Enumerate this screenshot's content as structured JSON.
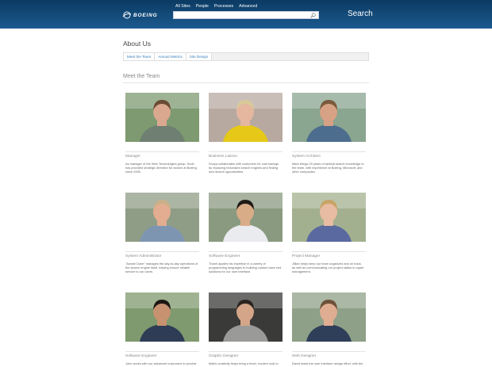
{
  "header": {
    "logo_text": "BOEING",
    "nav": [
      "All Sites",
      "People",
      "Processes",
      "Advanced"
    ],
    "search_placeholder": "",
    "search_button": "Search"
  },
  "page": {
    "title": "About Us",
    "tabs": [
      "Meet the Team",
      "Annual Metrics",
      "Site Design"
    ],
    "section_title": "Meet the Team"
  },
  "team": [
    {
      "role": "Manager",
      "bio": "As manager of the Web Technologies group, Scott has provided strategic direction for search at Boeing since 2005.",
      "shirt": "#6f7f72",
      "skin": "#d9a88e",
      "hair": "#6b4a34",
      "bg": "#7d9a70"
    },
    {
      "role": "Business Liaison",
      "bio": "Sonya collaborates with customers for cost savings by replacing redundant search engines and finding new search opportunities.",
      "shirt": "#e6c818",
      "skin": "#e4b79e",
      "hair": "#d9c999",
      "bg": "#b8a9a0"
    },
    {
      "role": "System Architect",
      "bio": "Mark brings 25 years of tactical search knowledge to the team, with experience at Boeing, Microsoft, and other companies.",
      "shirt": "#4d6d8f",
      "skin": "#d6a184",
      "hair": "#7a5a3e",
      "bg": "#8aa590"
    },
    {
      "role": "System Administrator",
      "bio": "\"Aussie Dave\" manages the day-to-day operations of the search engine itself, helping ensure reliable service to our users.",
      "shirt": "#7e95b2",
      "skin": "#e2ad90",
      "hair": "#c9b08a",
      "bg": "#8f9d86"
    },
    {
      "role": "Software Engineer",
      "bio": "Thanh applies his expertise in a variety of programming languages to building custom back end solutions for our user interface.",
      "shirt": "#e9ebee",
      "skin": "#d9ac88",
      "hair": "#1e1a17",
      "bg": "#8a9a80"
    },
    {
      "role": "Project Manager",
      "bio": "Jillian helps keep our team organized and on track, as well as communicating our project status to upper management.",
      "shirt": "#5a6aa0",
      "skin": "#e8bca2",
      "hair": "#c9a466",
      "bg": "#a3b08f"
    },
    {
      "role": "Software Engineer",
      "bio": "John works with our advanced customers to provide",
      "shirt": "#2e3c55",
      "skin": "#c69270",
      "hair": "#1d1713",
      "bg": "#7f9a6e"
    },
    {
      "role": "Graphic Designer",
      "bio": "Matt's creativity helps bring a fresh, modern look to",
      "shirt": "#9a9a98",
      "skin": "#d4a588",
      "hair": "#2a2420",
      "bg": "#3a3a38"
    },
    {
      "role": "Web Designer",
      "bio": "David leads the user interface design effort, with the",
      "shirt": "#2f3e59",
      "skin": "#dfae92",
      "hair": "#6e5039",
      "bg": "#8ea087"
    }
  ]
}
